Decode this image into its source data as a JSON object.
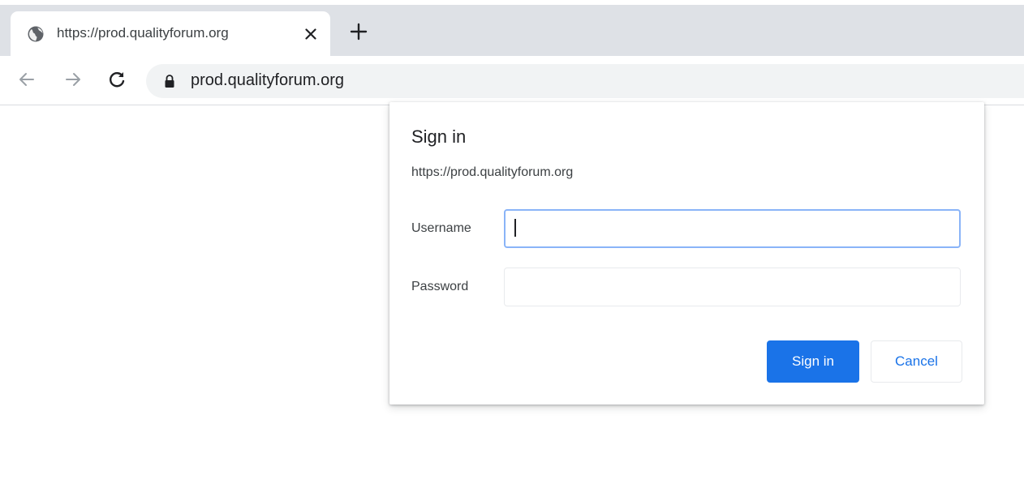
{
  "browser": {
    "tab": {
      "title": "https://prod.qualityforum.org",
      "favicon_icon": "globe-icon",
      "close_icon": "close-icon"
    },
    "new_tab_icon": "plus-icon",
    "toolbar": {
      "back_icon": "arrow-left-icon",
      "forward_icon": "arrow-right-icon",
      "reload_icon": "reload-icon",
      "lock_icon": "lock-icon",
      "url": "prod.qualityforum.org"
    },
    "colors": {
      "tabstrip_bg": "#dee1e6",
      "omnibox_bg": "#f1f3f4"
    }
  },
  "dialog": {
    "title": "Sign in",
    "origin": "https://prod.qualityforum.org",
    "username": {
      "label": "Username",
      "value": "",
      "focused": true
    },
    "password": {
      "label": "Password",
      "value": ""
    },
    "sign_in_label": "Sign in",
    "cancel_label": "Cancel",
    "colors": {
      "primary": "#1a73e8",
      "focus_ring": "#8ab4f8"
    }
  }
}
